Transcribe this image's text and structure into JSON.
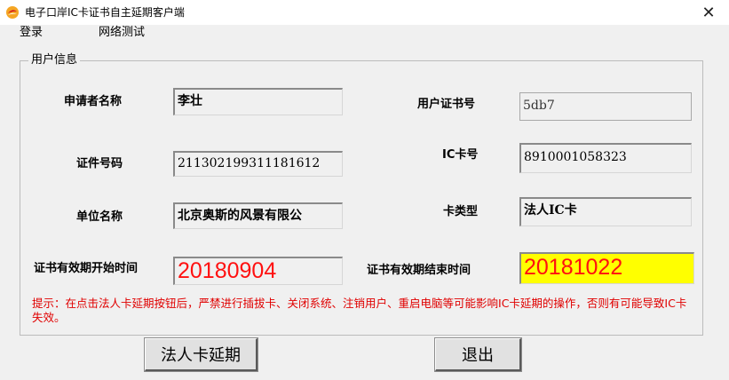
{
  "window": {
    "title": "电子口岸IC卡证书自主延期客户端",
    "close_glyph": "✕"
  },
  "menu": [
    {
      "label": "登录"
    },
    {
      "label": "网络测试"
    }
  ],
  "group": {
    "legend": "用户信息"
  },
  "fields": {
    "applicant_name": {
      "label": "申请者名称",
      "value": "李壮"
    },
    "user_cert_no": {
      "label": "用户证书号",
      "value": "5db7"
    },
    "id_number": {
      "label": "证件号码",
      "value": "211302199311181612"
    },
    "ic_card_no": {
      "label": "IC卡号",
      "value": "8910001058323"
    },
    "org_name": {
      "label": "单位名称",
      "value": "北京奥斯的风景有限公"
    },
    "card_type": {
      "label": "卡类型",
      "value": "法人IC卡"
    },
    "cert_start": {
      "label": "证书有效期开始时间",
      "value": "20180904"
    },
    "cert_end": {
      "label": "证书有效期结束时间",
      "value": "20181022"
    }
  },
  "hint": {
    "text": "提示：在点击法人卡延期按钮后，严禁进行插拔卡、关闭系统、注销用户、重启电脑等可能影响IC卡延期的操作，否则有可能导致IC卡失效。",
    "color": "#e00000"
  },
  "buttons": {
    "extend": "法人卡延期",
    "exit": "退出"
  },
  "colors": {
    "end_date_bg": "#ffff00",
    "date_text": "#ff1010"
  }
}
